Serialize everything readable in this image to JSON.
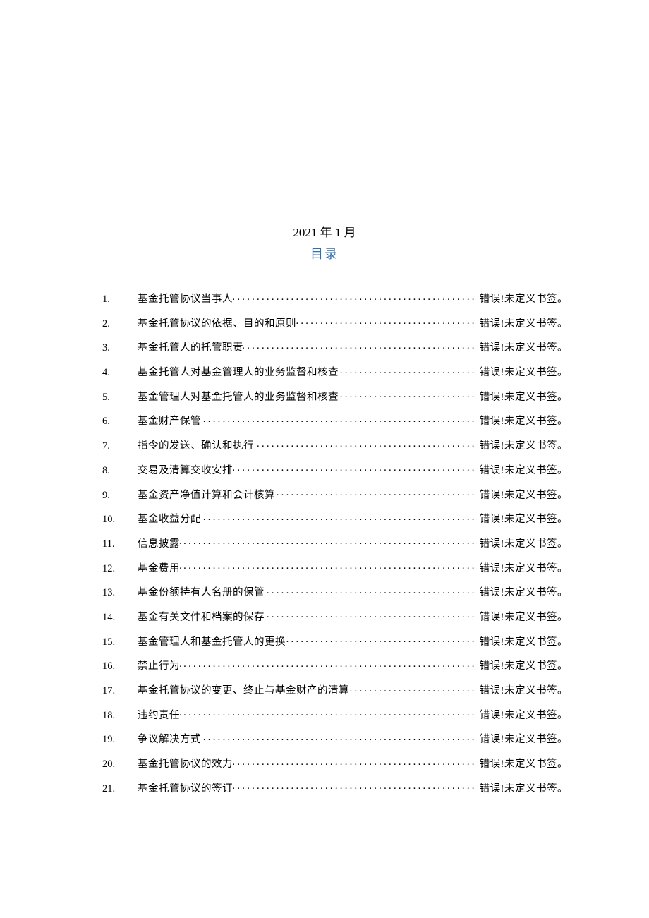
{
  "header": {
    "date": "2021 年 1 月",
    "toc_title": "目录"
  },
  "toc": {
    "error_text": "错误!未定义书签。",
    "items": [
      {
        "num": "1.",
        "title": "基金托管协议当事人"
      },
      {
        "num": "2.",
        "title": "基金托管协议的依据、目的和原则"
      },
      {
        "num": "3.",
        "title": "基金托管人的托管职责"
      },
      {
        "num": "4.",
        "title": "基金托管人对基金管理人的业务监督和核查"
      },
      {
        "num": "5.",
        "title": "基金管理人对基金托管人的业务监督和核查"
      },
      {
        "num": "6.",
        "title": "基金财产保管"
      },
      {
        "num": "7.",
        "title": "指令的发送、确认和执行"
      },
      {
        "num": "8.",
        "title": "交易及清算交收安排"
      },
      {
        "num": "9.",
        "title": "基金资产净值计算和会计核算"
      },
      {
        "num": "10.",
        "title": "基金收益分配"
      },
      {
        "num": "11.",
        "title": "信息披露"
      },
      {
        "num": "12.",
        "title": "基金费用"
      },
      {
        "num": "13.",
        "title": "基金份额持有人名册的保管"
      },
      {
        "num": "14.",
        "title": "基金有关文件和档案的保存"
      },
      {
        "num": "15.",
        "title": "基金管理人和基金托管人的更换"
      },
      {
        "num": "16.",
        "title": "禁止行为"
      },
      {
        "num": "17.",
        "title": "基金托管协议的变更、终止与基金财产的清算"
      },
      {
        "num": "18.",
        "title": "违约责任"
      },
      {
        "num": "19.",
        "title": "争议解决方式"
      },
      {
        "num": "20.",
        "title": "基金托管协议的效力"
      },
      {
        "num": "21.",
        "title": "基金托管协议的签订"
      }
    ]
  }
}
